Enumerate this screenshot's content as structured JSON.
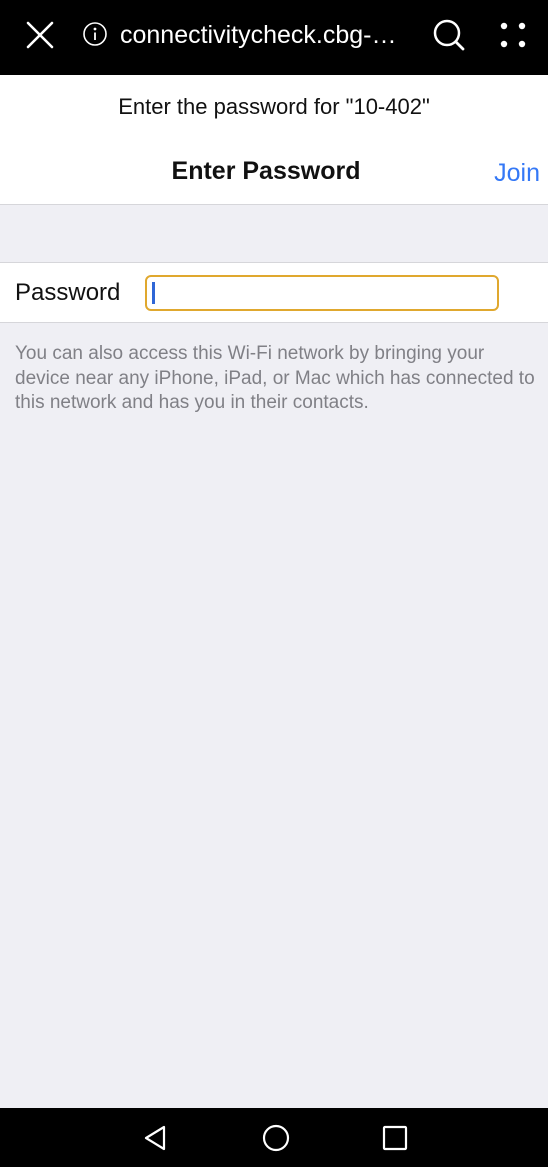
{
  "browser": {
    "url": "connectivitycheck.cbg-…"
  },
  "header": {
    "prompt": "Enter the password for \"10-402\"",
    "title": "Enter Password",
    "join_label": "Join"
  },
  "password_row": {
    "label": "Password",
    "value": ""
  },
  "help_text": "You can also access this Wi-Fi network by bringing your device near any iPhone, iPad, or Mac which has connected to this network and has you in their contacts.",
  "icons": {
    "close": "close-icon",
    "info": "info-icon",
    "search": "search-icon",
    "more": "more-icon",
    "back": "back-triangle-icon",
    "home": "home-circle-icon",
    "recents": "recents-square-icon"
  },
  "colors": {
    "accent": "#3478f6",
    "field_border": "#e0a82e",
    "caret": "#2f66d6"
  }
}
